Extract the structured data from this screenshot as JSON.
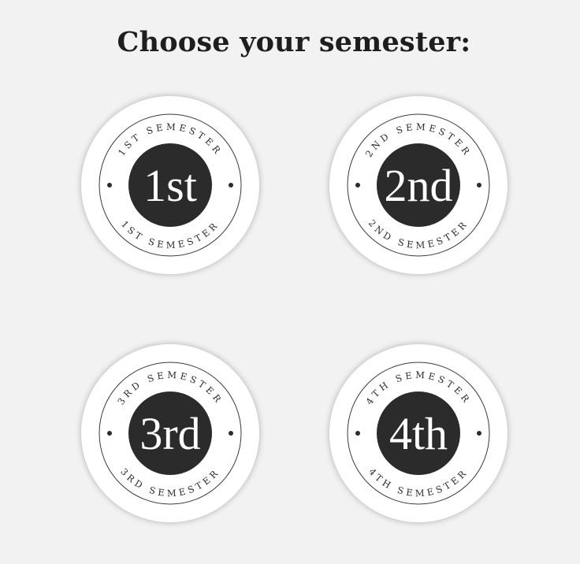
{
  "heading": "Choose your semester:",
  "semesters": [
    {
      "id": 1,
      "number": "1st",
      "top_text": "1ST SEMESTER",
      "bottom_text": "1ST SEMESTER"
    },
    {
      "id": 2,
      "number": "2nd",
      "top_text": "2ND SEMESTER",
      "bottom_text": "2ND SEMESTER"
    },
    {
      "id": 3,
      "number": "3rd",
      "top_text": "3RD SEMESTER",
      "bottom_text": "3RD SEMESTER"
    },
    {
      "id": 4,
      "number": "4th",
      "top_text": "4TH SEMESTER",
      "bottom_text": "4TH SEMESTER"
    }
  ],
  "colors": {
    "background": "#f2f2f2",
    "badge": "#ffffff",
    "center_disc": "#2b2b2b",
    "ink": "#2b2b2b"
  }
}
